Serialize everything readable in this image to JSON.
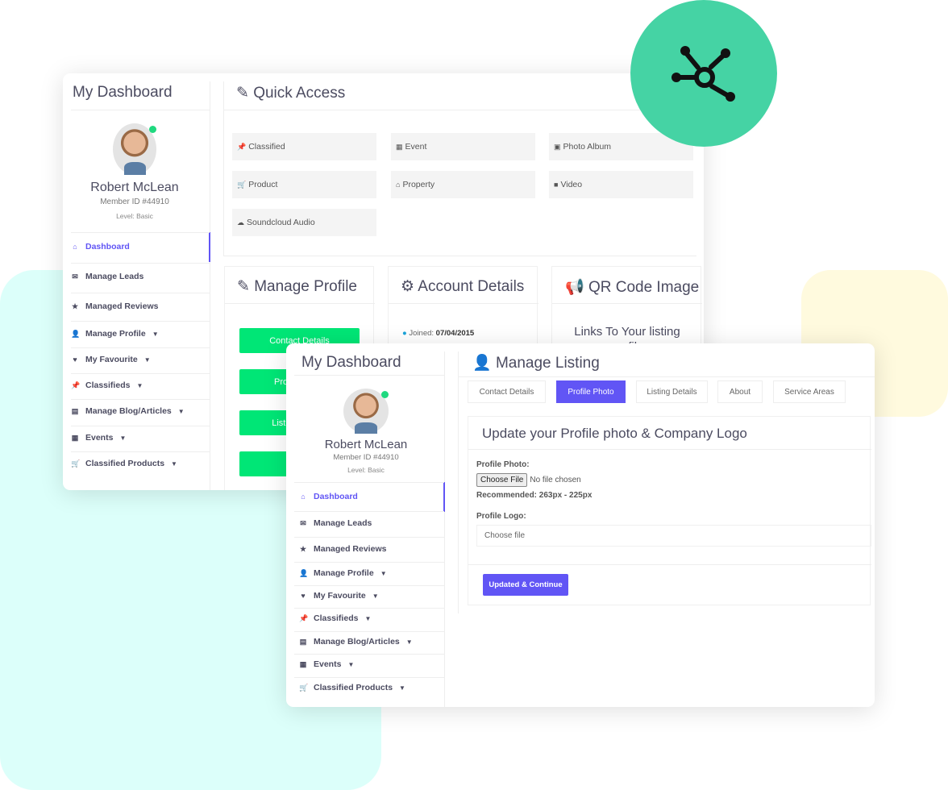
{
  "colors": {
    "accent": "#6155f5",
    "green": "#00e676",
    "teal": "#45d3a4",
    "online": "#1fd97f"
  },
  "badge_icon": "hub-network-icon",
  "sidebar": {
    "title": "My Dashboard",
    "user": {
      "name": "Robert McLean",
      "member_id": "Member ID #44910",
      "level": "Level: Basic"
    },
    "items": [
      {
        "label": "Dashboard",
        "icon": "home-icon",
        "active": true
      },
      {
        "label": "Manage Leads",
        "icon": "envelope-icon"
      },
      {
        "label": "Managed Reviews",
        "icon": "star-icon"
      },
      {
        "label": "Manage Profile",
        "icon": "user-icon",
        "dropdown": true
      },
      {
        "label": "My Favourite",
        "icon": "heart-icon",
        "dropdown": true
      },
      {
        "label": "Classifieds",
        "icon": "pin-icon",
        "dropdown": true
      },
      {
        "label": "Manage Blog/Articles",
        "icon": "file-icon",
        "dropdown": true
      },
      {
        "label": "Events",
        "icon": "calendar-icon",
        "dropdown": true
      },
      {
        "label": "Classified Products",
        "icon": "cart-icon",
        "dropdown": true
      }
    ]
  },
  "quick_access": {
    "title": "Quick Access",
    "tiles": [
      {
        "label": "Classified",
        "icon": "pin-icon"
      },
      {
        "label": "Event",
        "icon": "calendar-icon"
      },
      {
        "label": "Photo Album",
        "icon": "image-icon"
      },
      {
        "label": "Product",
        "icon": "cart-icon"
      },
      {
        "label": "Property",
        "icon": "home-icon"
      },
      {
        "label": "Video",
        "icon": "video-icon"
      },
      {
        "label": "Soundcloud Audio",
        "icon": "soundcloud-icon"
      }
    ]
  },
  "cards": {
    "manage_profile": {
      "title": "Manage Profile",
      "buttons": [
        "Contact Details",
        "Profile Photo",
        "Listing Details",
        ""
      ]
    },
    "account_details": {
      "title": "Account Details",
      "joined_label": "Joined:",
      "joined_value": "07/04/2015"
    },
    "qr_code": {
      "title": "QR Code Image",
      "text": "Links To Your listing profile"
    }
  },
  "listing": {
    "title": "Manage Listing",
    "tabs": [
      "Contact Details",
      "Profile Photo",
      "Listing Details",
      "About",
      "Service Areas"
    ],
    "active_tab": "Profile Photo",
    "panel_title": "Update your Profile photo & Company Logo",
    "profile_photo_label": "Profile Photo:",
    "choose_file_button": "Choose File",
    "no_file": "No file chosen",
    "recommended": "Recommended: 263px - 225px",
    "profile_logo_label": "Profile Logo:",
    "logo_placeholder": "Choose file",
    "submit": "Updated & Continue"
  }
}
